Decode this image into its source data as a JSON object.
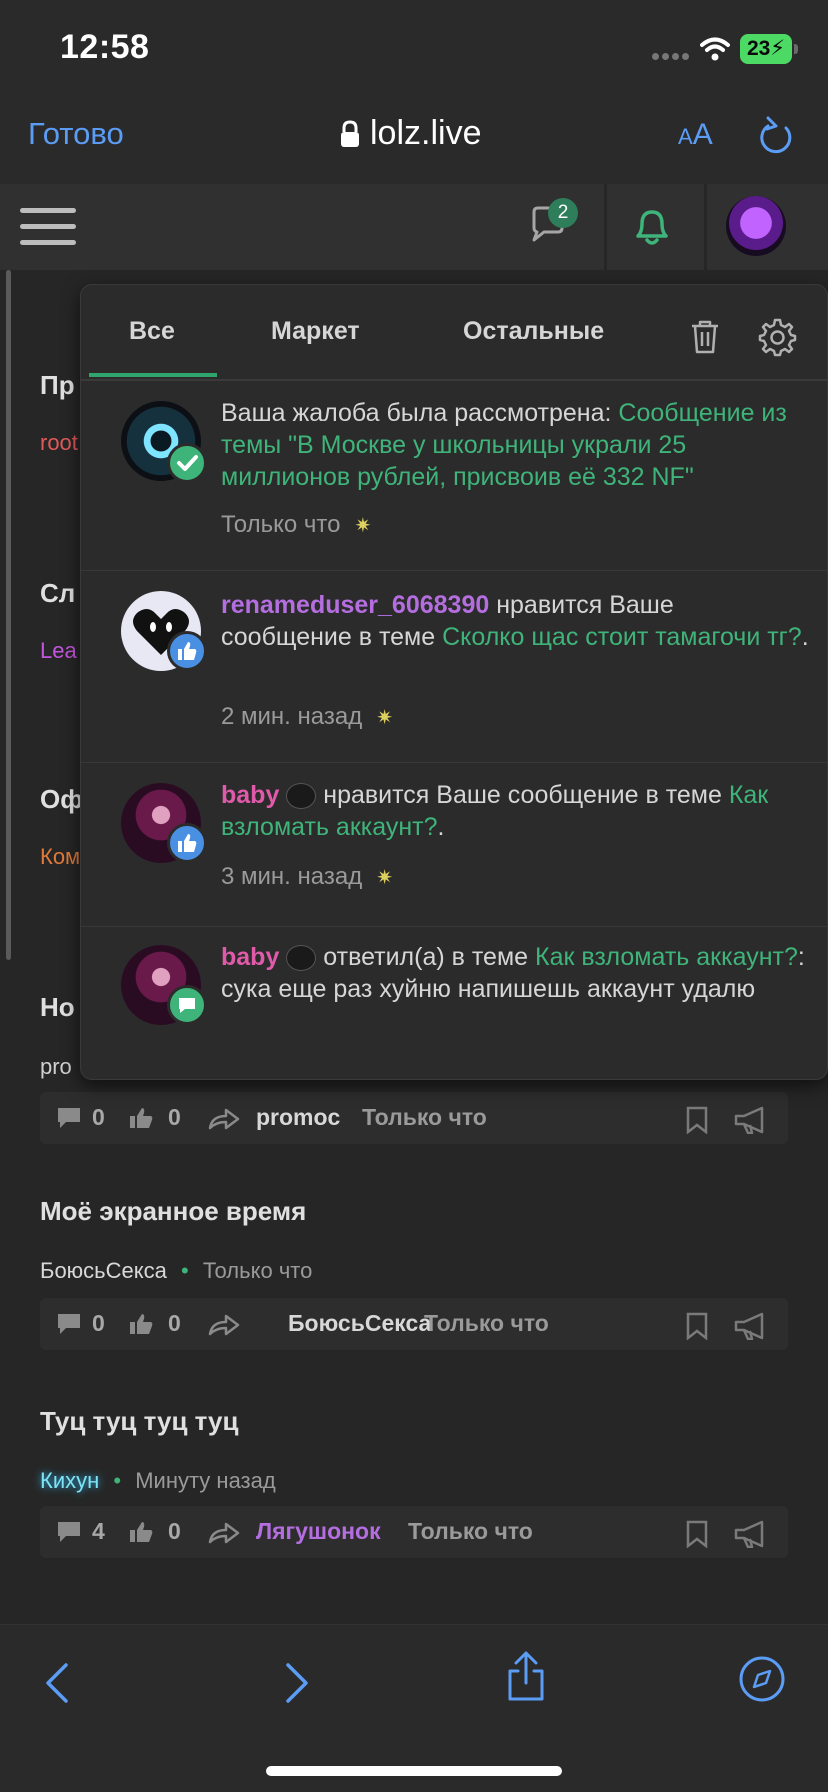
{
  "status_bar": {
    "time": "12:58",
    "battery": "23"
  },
  "browser": {
    "done_label": "Готово",
    "url": "lolz.live",
    "aa_label_small": "A",
    "aa_label_big": "A"
  },
  "header": {
    "conversation_count": "2"
  },
  "feed": [
    {
      "title": "Пр",
      "meta": "root"
    },
    {
      "title": "Сл",
      "meta": "Lea"
    },
    {
      "title": "Оф",
      "meta": "Ком"
    },
    {
      "title": "Но",
      "meta": "pro"
    },
    {
      "title": "Моё экранное время",
      "author": "БоюсьСекса",
      "dot": "•",
      "time": "Только что",
      "stats": {
        "replies": "0",
        "likes": "0",
        "last_user": "БоюсьСекса",
        "last_time": "Только что"
      }
    },
    {
      "title": "Туц туц туц туц",
      "author": "Кихун",
      "dot": "•",
      "time": "Минуту назад",
      "stats": {
        "replies": "4",
        "likes": "0",
        "last_user": "Лягушонок",
        "last_time": "Только что"
      }
    }
  ],
  "feed_stats_promo": {
    "replies": "0",
    "likes": "0",
    "last_user": "promoc",
    "last_time": "Только что"
  },
  "dropdown": {
    "tabs": [
      "Все",
      "Маркет",
      "Остальные"
    ],
    "notifications": [
      {
        "text": "Ваша жалоба была рассмотрена:",
        "link": "Сообщение из темы \"В Москве у школьницы украли 25 миллионов рублей, присвоив её 332 NF\"",
        "time": "Только что",
        "sparkle": "✷"
      },
      {
        "user": "renameduser_6068390",
        "text": "нравится Ваше сообщение в теме",
        "link": "Сколко щас стоит тамагочи тг?",
        "tail": ".",
        "time": "2 мин. назад",
        "sparkle": "✷"
      },
      {
        "user": "baby",
        "text": "нравится Ваше сообщение в теме",
        "link": "Как взломать аккаунт?",
        "tail": ".",
        "time": "3 мин. назад",
        "sparkle": "✷"
      },
      {
        "user": "baby",
        "text": "ответил(а) в теме",
        "link": "Как взломать аккаунт?",
        "tail": ":",
        "message": "сука еще раз хуйню напишешь аккаунт удалю"
      }
    ]
  },
  "colors": {
    "accent_green": "#3fb47a",
    "ios_blue": "#5b9cf5",
    "background": "#262626"
  }
}
